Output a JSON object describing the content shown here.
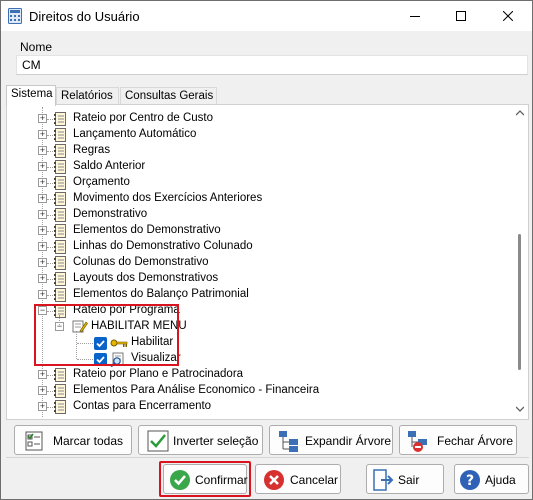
{
  "window": {
    "title": "Direitos do Usuário",
    "icon": "calculator-icon",
    "controls": [
      "minimize-icon",
      "maximize-icon",
      "close-icon"
    ]
  },
  "nome": {
    "label": "Nome",
    "value": "CM"
  },
  "tabs": [
    {
      "label": "Sistema",
      "active": true
    },
    {
      "label": "Relatórios",
      "active": false
    },
    {
      "label": "Consultas Gerais",
      "active": false
    }
  ],
  "tree": {
    "items": [
      {
        "label": "Rateio por Centro de Custo",
        "expander": "+"
      },
      {
        "label": "Lançamento Automático",
        "expander": "+"
      },
      {
        "label": "Regras",
        "expander": "+"
      },
      {
        "label": "Saldo Anterior",
        "expander": "+"
      },
      {
        "label": "Orçamento",
        "expander": "+"
      },
      {
        "label": "Movimento dos Exercícios Anteriores",
        "expander": "+"
      },
      {
        "label": "Demonstrativo",
        "expander": "+"
      },
      {
        "label": "Elementos do Demonstrativo",
        "expander": "+"
      },
      {
        "label": "Linhas do Demonstrativo Colunado",
        "expander": "+"
      },
      {
        "label": "Colunas do Demonstrativo",
        "expander": "+"
      },
      {
        "label": "Layouts dos Demonstrativos",
        "expander": "+"
      },
      {
        "label": "Elementos do Balanço Patrimonial",
        "expander": "+"
      },
      {
        "label": "Rateio por Programa",
        "expander": "−"
      },
      {
        "label": "HABILITAR MENU",
        "expander": "−"
      },
      {
        "label": "Habilitar",
        "checked": true,
        "icon": "key-icon"
      },
      {
        "label": "Visualizar",
        "checked": true,
        "icon": "magnifier-icon"
      },
      {
        "label": "Rateio por Plano e Patrocinadora",
        "expander": "+"
      },
      {
        "label": "Elementos Para Análise Economico - Financeira",
        "expander": "+"
      },
      {
        "label": "Contas para Encerramento",
        "expander": "+"
      }
    ]
  },
  "actions": {
    "marcar_todas": "Marcar todas",
    "inverter_selecao": "Inverter seleção",
    "expandir_arvore": "Expandir Árvore",
    "fechar_arvore": "Fechar Árvore"
  },
  "footer": {
    "confirmar": "Confirmar",
    "cancelar": "Cancelar",
    "sair": "Sair",
    "ajuda": "Ajuda"
  },
  "colors": {
    "highlight": "#d9141f",
    "checkbox": "#0a63c9"
  }
}
